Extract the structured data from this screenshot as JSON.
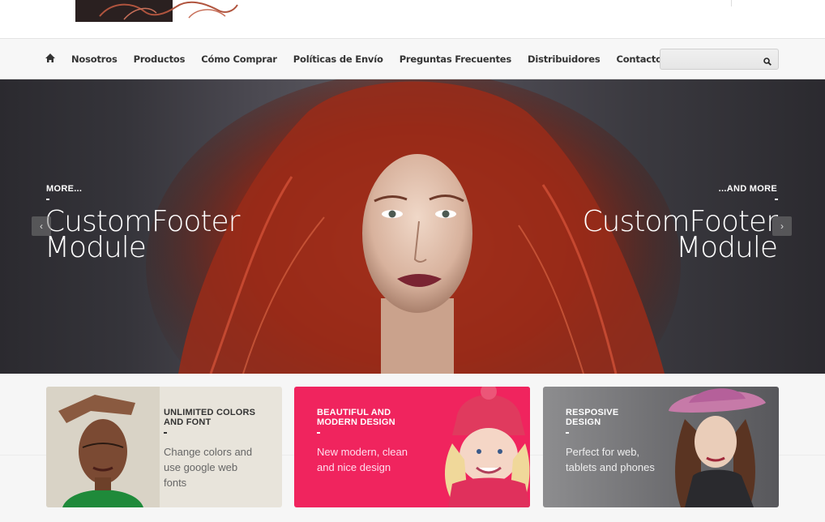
{
  "nav": {
    "home_icon": "home-icon",
    "items": [
      "Nosotros",
      "Productos",
      "Cómo Comprar",
      "Políticas de Envío",
      "Preguntas Frecuentes",
      "Distribuidores",
      "Contacto"
    ],
    "search": {
      "value": "",
      "placeholder": "",
      "icon": "search-icon"
    }
  },
  "hero": {
    "left_label": "MORE...",
    "left_title_line1": "CustomFooter",
    "left_title_line2": "Module",
    "right_label": "...AND MORE",
    "right_title_line1": "CustomFooter",
    "right_title_line2": "Module",
    "prev_glyph": "‹",
    "next_glyph": "›"
  },
  "features": [
    {
      "title": "UNLIMITED COLORS AND FONT",
      "dash": "-",
      "text": "Change colors and use google web fonts"
    },
    {
      "title": "BEAUTIFUL AND MODERN DESIGN",
      "dash": "-",
      "text": "New modern, clean and nice design"
    },
    {
      "title": "RESPOSIVE DESIGN",
      "dash": "-",
      "text": "Perfect for web, tablets and phones"
    }
  ],
  "colors": {
    "accent_pink": "#f0245e",
    "hair_red": "#b3331f",
    "nav_bg": "#f7f7f7"
  }
}
